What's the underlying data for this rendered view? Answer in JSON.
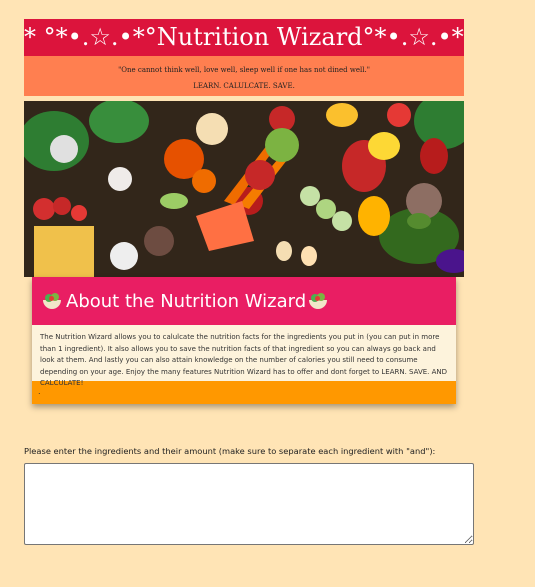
{
  "header": {
    "title": "* °*•.☆.•*°Nutrition Wizard°*•.☆.•*° *",
    "quote": "\"One cannot think well, love well, sleep well if one has not dined well.\"",
    "motto": "LEARN. CALULCATE. SAVE."
  },
  "hero": {
    "alt": "Assorted fresh vegetables and fruits"
  },
  "about": {
    "title": "About the Nutrition Wizard",
    "icon": "salad-icon",
    "body": "The Nutrition Wizard allows you to calulcate the nutrition facts for the ingredients you put in (you can put in more than 1 ingredient). It also allows you to save the nutrition facts of that ingredient so you can always go back and look at them. And lastly you can also attain knowledge on the number of calories you still need to consume depending on your age. Enjoy the many features Nutrition Wizard has to offer and dont forget to LEARN. SAVE. AND CALCULATE!",
    "footer": "."
  },
  "form": {
    "prompt": "Please enter the ingredients and their amount (make sure to separate each ingredient with \"and\"):",
    "value": ""
  },
  "colors": {
    "page_bg": "#ffe4b5",
    "title_bar": "#dc143c",
    "subtitle_bar": "#ff7f50",
    "card_header": "#e91e63",
    "card_footer": "#ff9800"
  }
}
